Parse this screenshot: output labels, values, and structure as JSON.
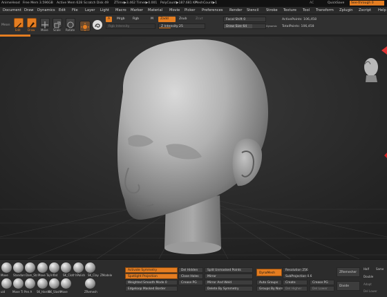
{
  "status_bar": {
    "project": "AnimeHead",
    "free_mem": "Free Mem 3.596GB",
    "active_mem": "Active Mem 628",
    "scratch_disk": "Scratch Disk 49",
    "ztime": "ZTime▶3.462 Timer▶0.001",
    "polycount": "PolyCount▶187.681 KP",
    "meshcount": "MeshCount▶1",
    "ac": "AC",
    "quicksave": "QuickSave",
    "seethrough": "See-through  0"
  },
  "menu": [
    "Document",
    "Draw",
    "Dynamics",
    "Edit",
    "File",
    "Layer",
    "Light",
    "Macro",
    "Marker",
    "Material",
    "Movie",
    "Picker",
    "Preferences",
    "Render",
    "Stencil",
    "Stroke",
    "Texture",
    "Tool",
    "Transform",
    "Zplugin",
    "Zscript",
    "Help"
  ],
  "shelf": {
    "mode_label": "Mean",
    "tools": [
      {
        "label": "Edit",
        "icon": "edit-icon"
      },
      {
        "label": "Draw",
        "icon": "draw-icon"
      },
      {
        "label": "Move",
        "icon": "move-icon"
      },
      {
        "label": "Scale",
        "icon": "scale-icon"
      },
      {
        "label": "Rotate",
        "icon": "rotate-icon"
      }
    ],
    "a_label": "A",
    "mrgb": "Mrgb",
    "rgb": "Rgb",
    "m": "M",
    "zadd": "Zadd",
    "zsub": "Zsub",
    "zcut": "Zcut",
    "rgb_intensity": "Rgb Intensity",
    "z_intensity": "Z Intensity 25",
    "z_intensity_value": 0.25,
    "focal_shift": "Focal Shift 0",
    "draw_size": "Draw Size 64",
    "dynamic": "Dynamic",
    "active_points": "ActivePoints: 106,458",
    "total_points": "TotalPoints: 106,458"
  },
  "bottom": {
    "brushes_row1": [
      "",
      "",
      "",
      "",
      "",
      "",
      "",
      ""
    ],
    "brushes_row2": [
      {
        "label": "Move T"
      },
      {
        "label": "ClayBuildup"
      },
      {
        "label": "TrimDynamic"
      },
      {
        "label": "Pinch"
      },
      {
        "label": "hPolish"
      },
      {
        "label": "SK_ClayFill"
      },
      {
        "label": "SK_Slash"
      }
    ],
    "brush_labels": [
      "Move",
      "Standard",
      "Dam_Standard",
      "Move Topo",
      "Inflat",
      "SK_Cloth",
      "hPolish",
      "SK_Clay",
      "ZModeler"
    ],
    "row3_labels": [
      "uid",
      "Move Ti",
      "Pen A",
      "SK_HardA",
      "SK_Slash",
      "Move",
      "ZRemesh"
    ],
    "col1": [
      "Activate Symmetry",
      "Spotlight Projection",
      "Weighted Smooth Mode 0",
      "Edgeloop Masked Border"
    ],
    "col2": [
      "Del Hidden",
      "Close Holes",
      "Crease PG",
      ""
    ],
    "col3": [
      "Split Unmasked Points",
      "Mirror",
      "Mirror And Weld",
      "Delete By Symmetry"
    ],
    "dynamesh": "DynaMesh",
    "col4": [
      "Resolution 256",
      "SubProjection 0.6"
    ],
    "col4b": [
      "Auto Groups",
      "Groups By Normals"
    ],
    "col5": [
      "Create",
      "Create",
      "Del Higher"
    ],
    "col5b": [
      "Crease PG",
      "Del Lower"
    ],
    "zremesher": "ZRemesher",
    "divide": "Divide",
    "right": [
      "Half",
      "Double",
      "Same",
      "Adapt",
      "Double",
      "Del Lower"
    ]
  }
}
